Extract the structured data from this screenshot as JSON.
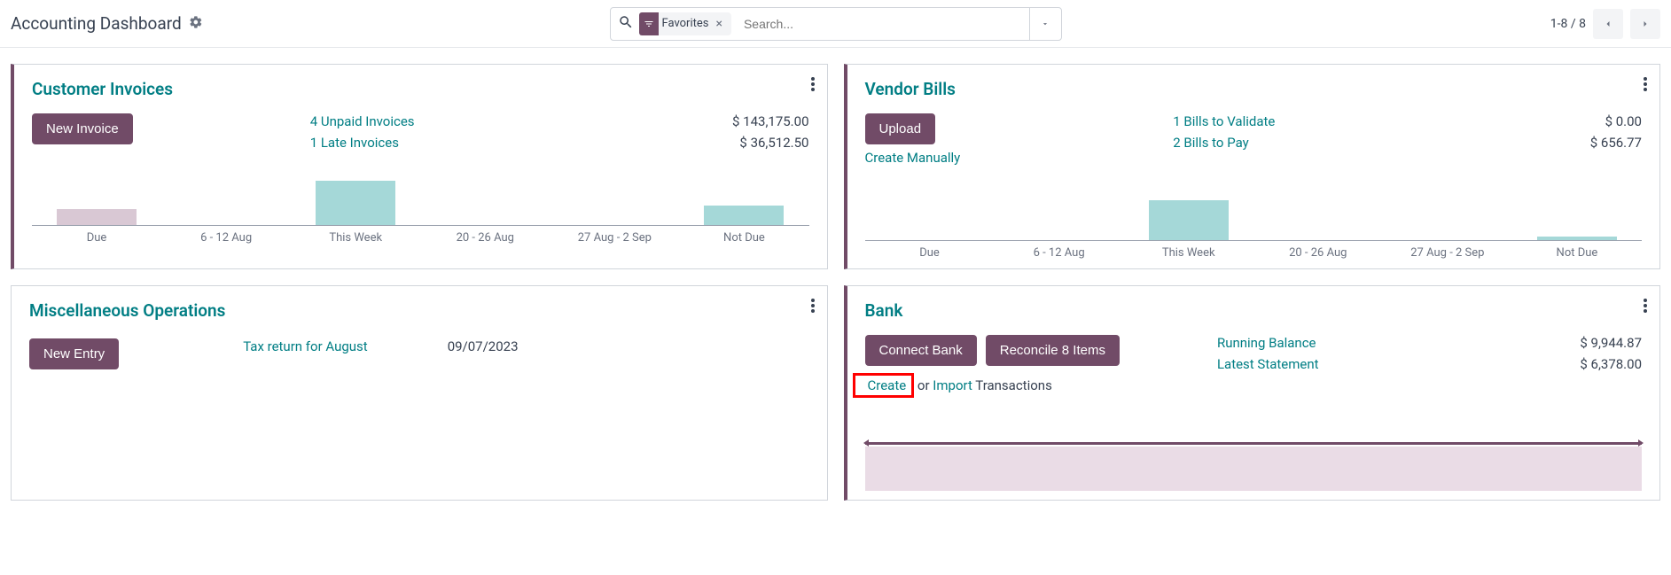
{
  "header": {
    "title": "Accounting Dashboard",
    "search_filter_label": "Favorites",
    "search_placeholder": "Search...",
    "pager": "1-8 / 8"
  },
  "cards": {
    "customer_invoices": {
      "title": "Customer Invoices",
      "new_button": "New Invoice",
      "lines": [
        {
          "label": "4 Unpaid Invoices",
          "amount": "$ 143,175.00"
        },
        {
          "label": "1 Late Invoices",
          "amount": "$ 36,512.50"
        }
      ]
    },
    "vendor_bills": {
      "title": "Vendor Bills",
      "upload_button": "Upload",
      "create_manually": "Create Manually",
      "lines": [
        {
          "label": "1 Bills to Validate",
          "amount": "$ 0.00"
        },
        {
          "label": "2 Bills to Pay",
          "amount": "$ 656.77"
        }
      ]
    },
    "misc": {
      "title": "Miscellaneous Operations",
      "new_button": "New Entry",
      "item_label": "Tax return for August",
      "item_date": "09/07/2023"
    },
    "bank": {
      "title": "Bank",
      "connect_button": "Connect Bank",
      "reconcile_button": "Reconcile 8 Items",
      "sub_create": "Create",
      "sub_or": " or ",
      "sub_import": "Import",
      "sub_tx": " Transactions",
      "lines": [
        {
          "label": "Running Balance",
          "amount": "$ 9,944.87"
        },
        {
          "label": "Latest Statement",
          "amount": "$ 6,378.00"
        }
      ]
    }
  },
  "chart_data": [
    {
      "type": "bar",
      "owner": "customer_invoices",
      "categories": [
        "Due",
        "6 - 12 Aug",
        "This Week",
        "20 - 26 Aug",
        "27 Aug - 2 Sep",
        "Not Due"
      ],
      "values": [
        18,
        0,
        50,
        0,
        0,
        22
      ],
      "title": "",
      "xlabel": "",
      "ylabel": "",
      "ylim": [
        0,
        60
      ]
    },
    {
      "type": "bar",
      "owner": "vendor_bills",
      "categories": [
        "Due",
        "6 - 12 Aug",
        "This Week",
        "20 - 26 Aug",
        "27 Aug - 2 Sep",
        "Not Due"
      ],
      "values": [
        0,
        0,
        45,
        0,
        0,
        4
      ],
      "title": "",
      "xlabel": "",
      "ylabel": "",
      "ylim": [
        0,
        60
      ]
    }
  ]
}
